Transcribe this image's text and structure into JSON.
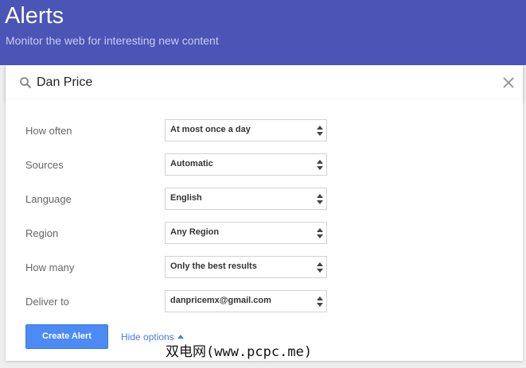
{
  "header": {
    "title": "Alerts",
    "subtitle": "Monitor the web for interesting new content"
  },
  "search": {
    "value": "Dan Price",
    "icon": "search-icon",
    "clear_icon": "close-icon"
  },
  "options": [
    {
      "label": "How often",
      "value": "At most once a day"
    },
    {
      "label": "Sources",
      "value": "Automatic"
    },
    {
      "label": "Language",
      "value": "English"
    },
    {
      "label": "Region",
      "value": "Any Region"
    },
    {
      "label": "How many",
      "value": "Only the best results"
    },
    {
      "label": "Deliver to",
      "value": "danpricemx@gmail.com"
    }
  ],
  "actions": {
    "create_label": "Create Alert",
    "hide_options_label": "Hide options"
  },
  "watermark": "双电网(www.pcpc.me)",
  "colors": {
    "header_bg": "#4a55b6",
    "button_bg": "#4c8bf5",
    "link": "#4c7ae0"
  }
}
